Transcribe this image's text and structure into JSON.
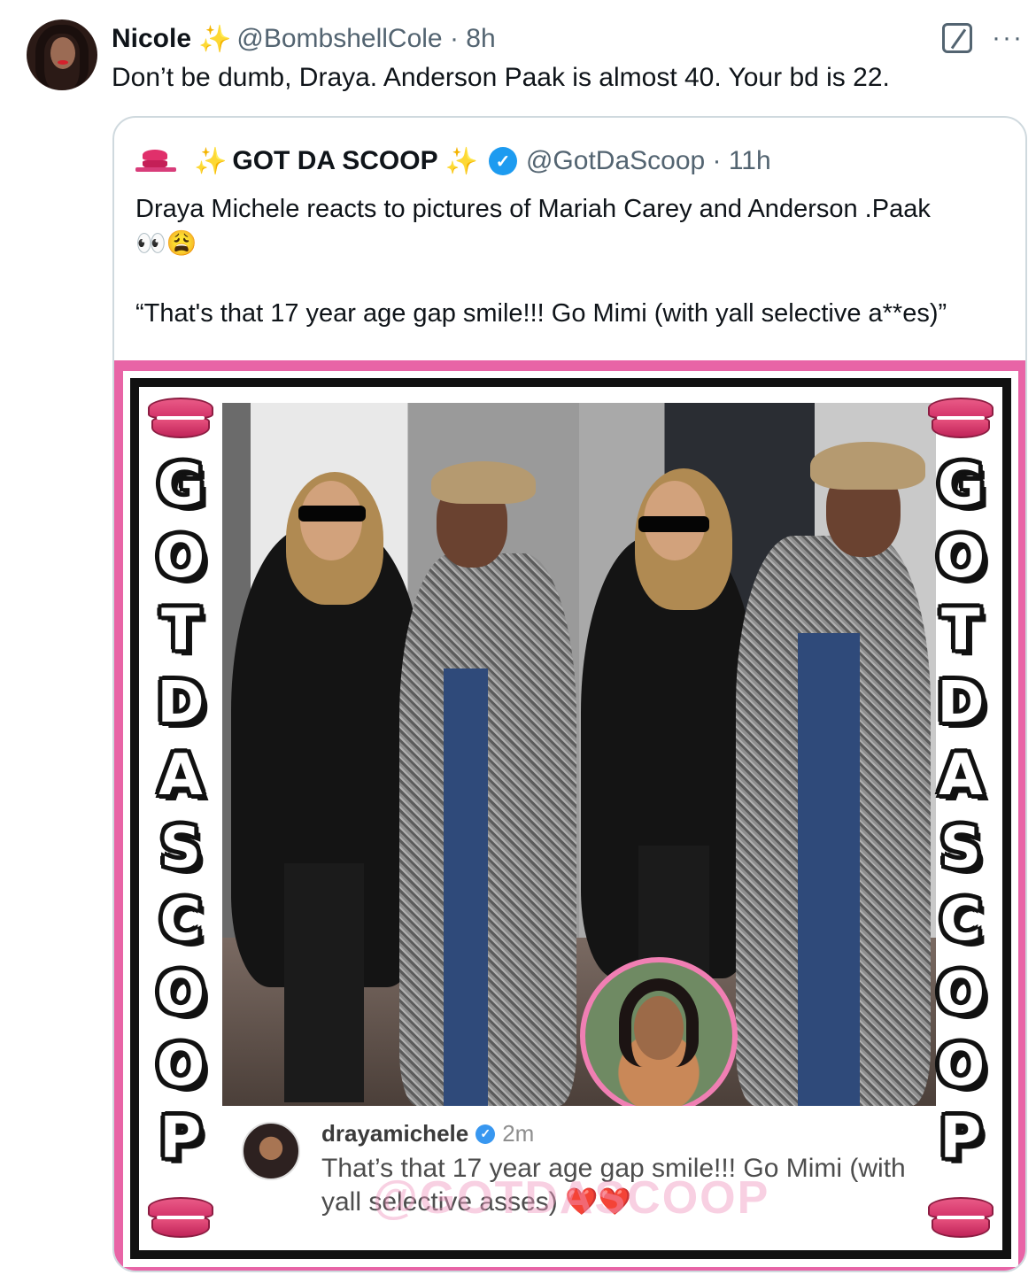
{
  "tweet": {
    "author_name": "Nicole",
    "sparkle_glyph": "✨",
    "handle_time": "@BombshellCole · 8h",
    "text": "Don’t be dumb, Draya. Anderson Paak is almost 40. Your bd is 22.",
    "more_glyph": "···"
  },
  "quoted": {
    "name": "GOT DA SCOOP",
    "sparkle_left": "✨",
    "sparkle_right": "✨",
    "verified_glyph": "✓",
    "handle_time": "@GotDaScoop · 11h",
    "text_line1": "Draya Michele reacts to pictures of Mariah Carey and Anderson .Paak",
    "text_line2": "👀😩",
    "text_quote": "“That's that 17 year age gap smile!!! Go Mimi (with yall selective a**es)”"
  },
  "media": {
    "side_letters": [
      "G",
      "O",
      "T",
      "D",
      "A",
      "S",
      "C",
      "O",
      "O",
      "P"
    ],
    "ig_user": "drayamichele",
    "ig_verified_glyph": "✓",
    "ig_time": "2m",
    "ig_text": "That’s that 17 year age gap smile!!! Go Mimi (with yall selective asses)",
    "ig_hearts": "❤️❤️",
    "watermark": "@GOTDASCOOP"
  },
  "colors": {
    "accent_pink": "#e864a6",
    "verified_blue": "#1d9bf0",
    "secondary_text": "#536471"
  }
}
